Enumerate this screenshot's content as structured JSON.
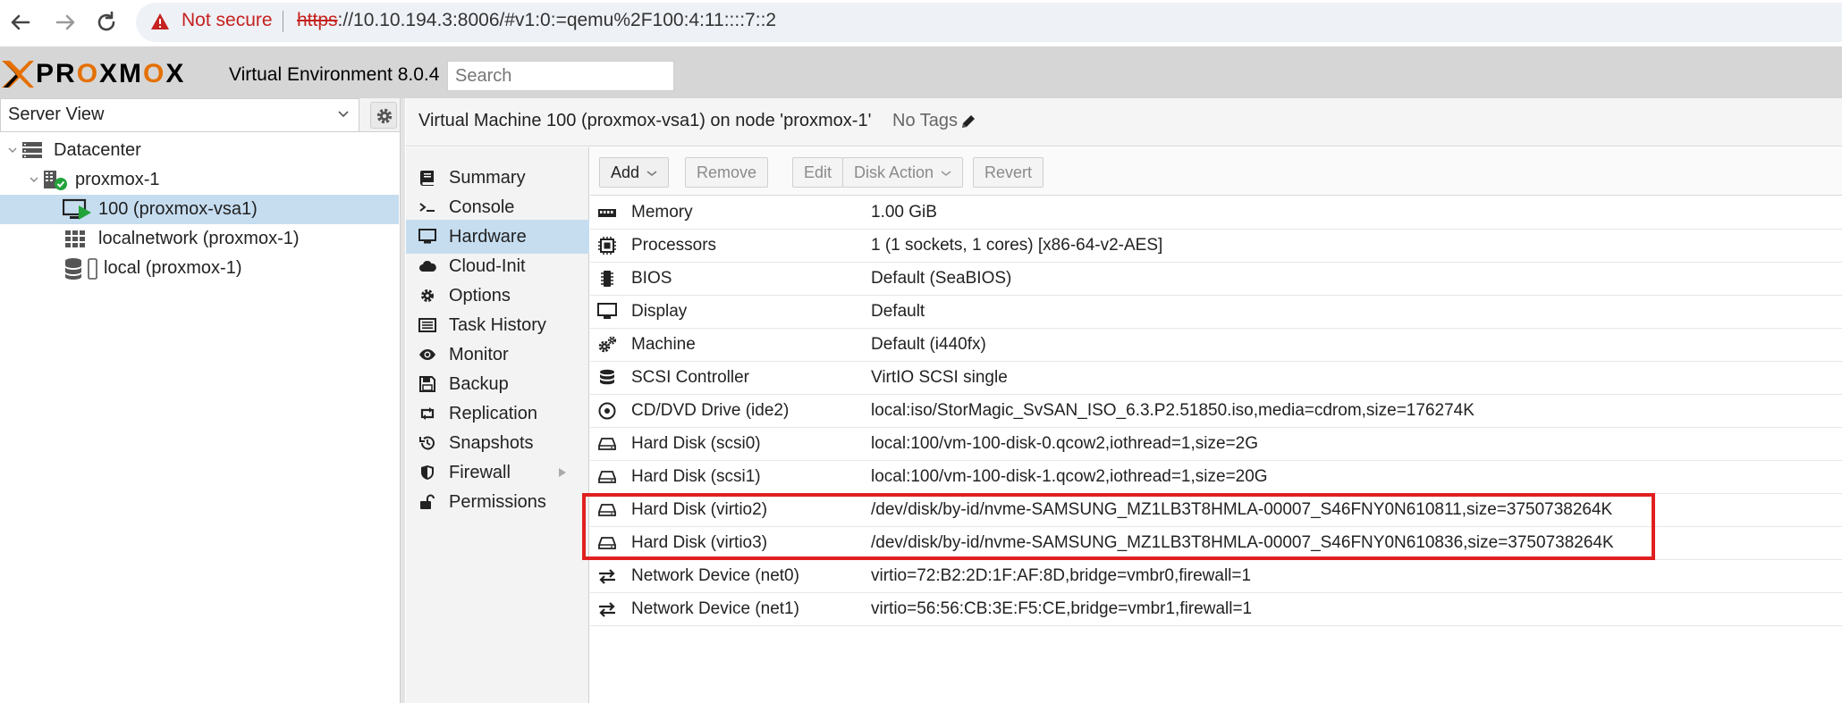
{
  "browser": {
    "security_text": "Not secure",
    "url_scheme": "https",
    "url_rest": "://10.10.194.3:8006/#v1:0:=qemu%2F100:4:11::::7::2"
  },
  "header": {
    "logo_text_1": "PR",
    "logo_text_o1": "O",
    "logo_text_2": "XM",
    "logo_text_o2": "O",
    "logo_text_3": "X",
    "version": "Virtual Environment 8.0.4",
    "search_placeholder": "Search"
  },
  "tree": {
    "view_label": "Server View",
    "nodes": [
      {
        "label": "Datacenter"
      },
      {
        "label": "proxmox-1"
      },
      {
        "label": "100 (proxmox-vsa1)"
      },
      {
        "label": "localnetwork (proxmox-1)"
      },
      {
        "label": "local (proxmox-1)"
      }
    ]
  },
  "content": {
    "title": "Virtual Machine 100 (proxmox-vsa1) on node 'proxmox-1'",
    "tags": "No Tags"
  },
  "menu": [
    {
      "label": "Summary"
    },
    {
      "label": "Console"
    },
    {
      "label": "Hardware"
    },
    {
      "label": "Cloud-Init"
    },
    {
      "label": "Options"
    },
    {
      "label": "Task History"
    },
    {
      "label": "Monitor"
    },
    {
      "label": "Backup"
    },
    {
      "label": "Replication"
    },
    {
      "label": "Snapshots"
    },
    {
      "label": "Firewall"
    },
    {
      "label": "Permissions"
    }
  ],
  "toolbar": {
    "add": "Add",
    "remove": "Remove",
    "edit": "Edit",
    "disk_action": "Disk Action",
    "revert": "Revert"
  },
  "hardware": [
    {
      "name": "Memory",
      "value": "1.00 GiB"
    },
    {
      "name": "Processors",
      "value": "1 (1 sockets, 1 cores) [x86-64-v2-AES]"
    },
    {
      "name": "BIOS",
      "value": "Default (SeaBIOS)"
    },
    {
      "name": "Display",
      "value": "Default"
    },
    {
      "name": "Machine",
      "value": "Default (i440fx)"
    },
    {
      "name": "SCSI Controller",
      "value": "VirtIO SCSI single"
    },
    {
      "name": "CD/DVD Drive (ide2)",
      "value": "local:iso/StorMagic_SvSAN_ISO_6.3.P2.51850.iso,media=cdrom,size=176274K"
    },
    {
      "name": "Hard Disk (scsi0)",
      "value": "local:100/vm-100-disk-0.qcow2,iothread=1,size=2G"
    },
    {
      "name": "Hard Disk (scsi1)",
      "value": "local:100/vm-100-disk-1.qcow2,iothread=1,size=20G"
    },
    {
      "name": "Hard Disk (virtio2)",
      "value": "/dev/disk/by-id/nvme-SAMSUNG_MZ1LB3T8HMLA-00007_S46FNY0N610811,size=3750738264K"
    },
    {
      "name": "Hard Disk (virtio3)",
      "value": "/dev/disk/by-id/nvme-SAMSUNG_MZ1LB3T8HMLA-00007_S46FNY0N610836,size=3750738264K"
    },
    {
      "name": "Network Device (net0)",
      "value": "virtio=72:B2:2D:1F:AF:8D,bridge=vmbr0,firewall=1"
    },
    {
      "name": "Network Device (net1)",
      "value": "virtio=56:56:CB:3E:F5:CE,bridge=vmbr1,firewall=1"
    }
  ]
}
